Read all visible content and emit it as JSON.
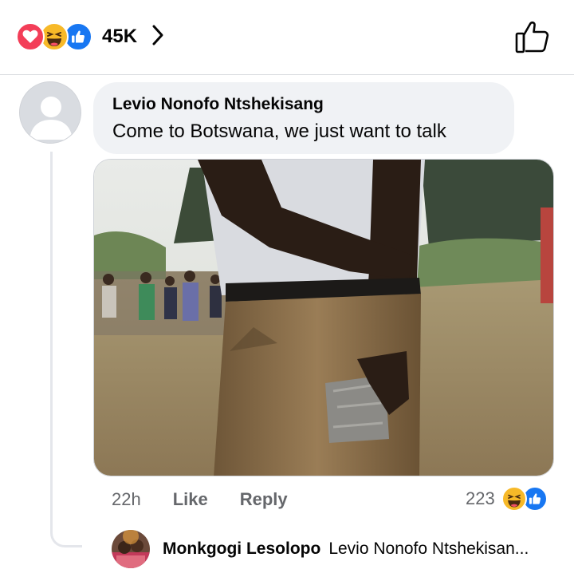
{
  "header": {
    "reactions": [
      "love-icon",
      "haha-icon",
      "like-icon"
    ],
    "reaction_count": "45K",
    "colors": {
      "love": "#f33e58",
      "haha": "#f7b928",
      "like": "#1877f2"
    }
  },
  "comment": {
    "author": "Levio Nonofo Ntshekisang",
    "text": "Come to Botswana, we just want to talk",
    "time": "22h",
    "like_label": "Like",
    "reply_label": "Reply",
    "reaction_count": "223",
    "reactions": [
      "haha-icon",
      "like-icon"
    ]
  },
  "reply": {
    "author": "Monkgogi Lesolopo",
    "preview": "Levio Nonofo Ntshekisan..."
  }
}
